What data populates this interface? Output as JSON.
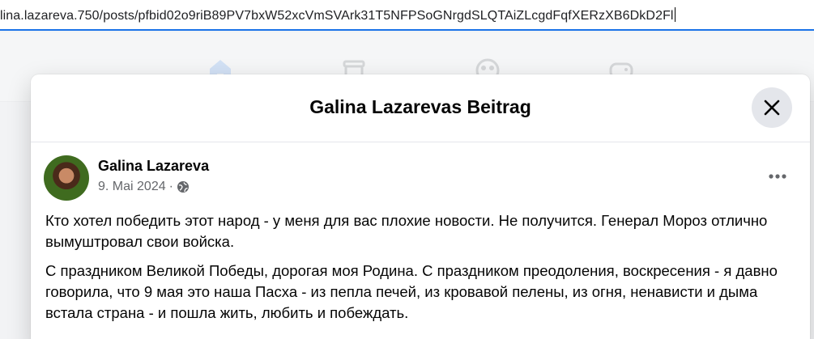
{
  "browser": {
    "url": "lina.lazareva.750/posts/pfbid02o9riB89PV7bxW52xcVmSVArk31T5NFPSoGNrgdSLQTAiZLcgdFqfXERzXB6DkD2Fl"
  },
  "nav": {
    "icons": [
      "home-icon",
      "marketplace-icon",
      "groups-icon",
      "gaming-icon"
    ]
  },
  "modal": {
    "title": "Galina Lazarevas Beitrag",
    "close_icon": "close-icon"
  },
  "post": {
    "author": "Galina Lazareva",
    "date": "9. Mai 2024",
    "separator": "·",
    "privacy_icon": "globe-icon",
    "more_icon": "more-horizontal-icon",
    "paragraphs": [
      "Кто хотел победить этот народ - у меня для вас плохие новости. Не получится. Генерал Мороз отлично вымуштровал свои войска.",
      "С праздником Великой Победы, дорогая моя Родина. С праздником преодоления, воскресения - я давно говорила, что 9 мая это наша Пасха -  из пепла печей, из кровавой пелены, из огня, ненависти и дыма встала страна - и пошла жить, любить и побеждать."
    ]
  },
  "colors": {
    "accent": "#1a73e8",
    "text_primary": "#050505",
    "text_secondary": "#65676b",
    "button_bg": "#e4e6eb"
  }
}
